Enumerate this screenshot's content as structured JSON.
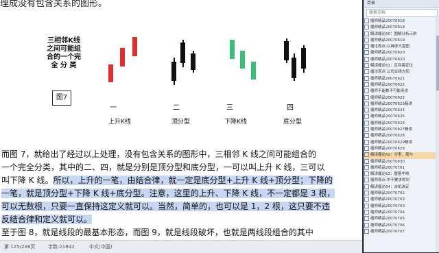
{
  "document": {
    "top_text": "理成没有包含关系的图形。",
    "figure_description_lines": [
      "三相邻K线",
      "之间可能组",
      "合的一个完",
      "全 分 类"
    ],
    "figure_label": "图7",
    "captions": [
      {
        "num": "一",
        "label": "上升K线"
      },
      {
        "num": "二",
        "label": "顶分型"
      },
      {
        "num": "三",
        "label": "下降K线"
      },
      {
        "num": "四",
        "label": "底分型"
      }
    ],
    "paragraph_lines": [
      "   而图 7，就给出了经过以上处理，没有包含关系的图形中，三相邻 K 线之间可能组合的",
      "一个完全分类，其中的二、四，就是分别是顶分型和底分型，一可以叫上升 K 线，三可以",
      "叫下降 K 线。",
      "所以，上升的一笔，由结合律，就一定是底分型+上升 K 线+顶分型；下降的",
      "一笔，就是顶分型+下降 K 线+底分型。注意，这里的上升、下降 K 线，不一定都是 3 根，",
      "可以无数根，只要一直保持这定义就可以。当然，简单的，也可以是 1，2 根，这只要不违",
      "反结合律和定义就可以。",
      "   至于图 8，就是线段的最基本形态，而图 9，就是线段破坏，也就是两线段组合的其中"
    ],
    "colors": {
      "up": "#e02e2e",
      "black": "#111111",
      "down": "#3dbb7b",
      "highlight": "#c7d6f2"
    }
  },
  "statusbar": {
    "page": "第 125/238页",
    "words": "字数:21842",
    "lang": "中文(中国)"
  },
  "side_panel": {
    "title": "目录",
    "search_placeholder": "搜索文档",
    "items": [
      "缠师精品20070618",
      "缠师精品20070618",
      "解读缠论60：图解分析示例",
      "缠师精品20070619",
      "缠论观点:以具体大盘图",
      "缠师精品20070620",
      "缠师精品20070620",
      "解读缠论61：区间套定位",
      "缠论观点:公司业绩大阳",
      "缠师精品20070621",
      "缠师精品20070622",
      "缠师不能数不可能用途",
      "缠师精品20070622",
      "缠师精品20070623精讲",
      "缠师精品20070624",
      "缠师精品20070625",
      "缠师精品20070626",
      "缠师精品20070627精讲",
      "缠师精品20070628",
      "缠师精品20070629精讲",
      "缠师精品20070629",
      "解读缠论62：分型、笔与",
      "缠师精品20070630",
      "缠师精品20070701",
      "解读缠论63：替着中线",
      "缠师观点:中不要求得到",
      "解读缠论64：去机决定",
      "缠师精品20070702",
      "缠师精品20070703",
      "缠师精品20070703",
      "缠师精品20070704",
      "缠师精品20070705",
      "缠师精品20070706",
      "缠师精品20070707"
    ],
    "selected_index": 21
  }
}
